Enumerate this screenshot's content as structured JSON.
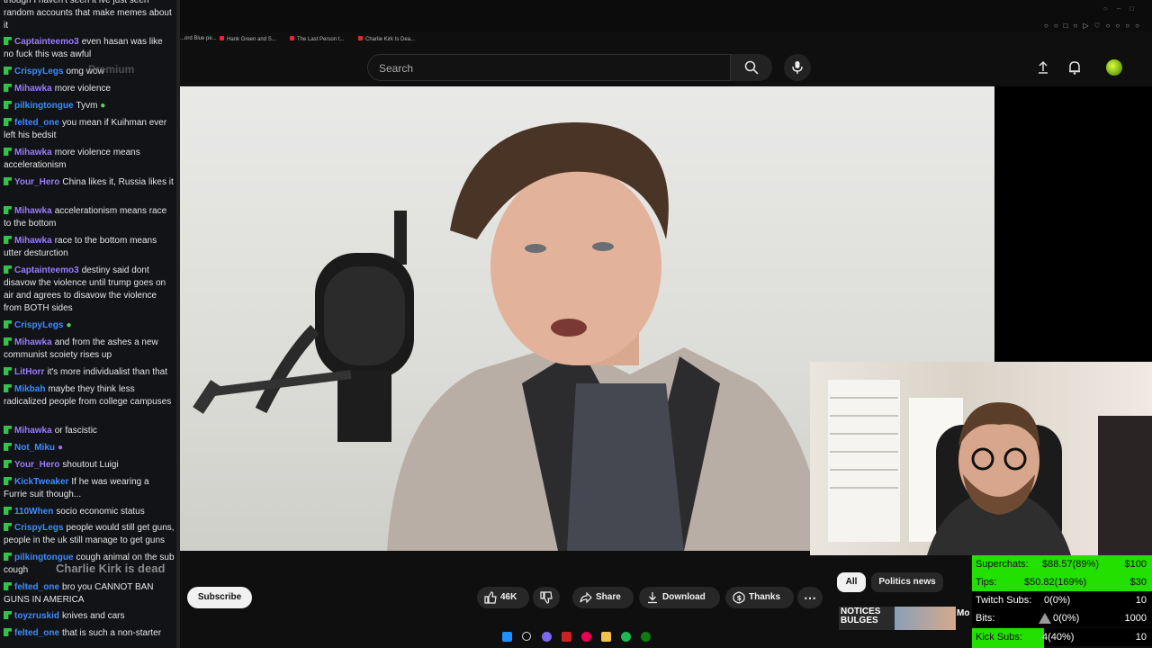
{
  "chat": {
    "messages": [
      {
        "user": "",
        "text": "though I haven't seen it ive just seen random accounts that make memes about it",
        "color": "#9b7bff"
      },
      {
        "user": "Captainteemo3",
        "text": "even hasan was like no fuck this was awful",
        "color": "#9b7bff"
      },
      {
        "user": "CrispyLegs",
        "text": "omg wow",
        "color": "#3d8cff"
      },
      {
        "user": "Mihawka",
        "text": "more violence",
        "color": "#9b7bff"
      },
      {
        "user": "pilkingtongue",
        "text": "Tyvm",
        "color": "#3d8cff"
      },
      {
        "user": "felted_one",
        "text": "you mean if Kuihman ever left his bedsit",
        "color": "#3d8cff"
      },
      {
        "user": "Mihawka",
        "text": "more violence means accelerationism",
        "color": "#9b7bff"
      },
      {
        "user": "Your_Hero",
        "text": "China likes it, Russia likes it",
        "color": "#9b7bff"
      },
      {
        "user": "Mihawka",
        "text": "accelerationism means race to the bottom",
        "color": "#9b7bff"
      },
      {
        "user": "Mihawka",
        "text": "race to the bottom means utter desturction",
        "color": "#9b7bff"
      },
      {
        "user": "Captainteemo3",
        "text": "destiny said dont disavow the violence until trump goes on air and agrees to disavow the violence from BOTH sides",
        "color": "#9b7bff"
      },
      {
        "user": "CrispyLegs",
        "text": "",
        "color": "#3d8cff"
      },
      {
        "user": "Mihawka",
        "text": "and from the ashes a new communist scoiety rises up",
        "color": "#9b7bff"
      },
      {
        "user": "LitHorr",
        "text": "it's more individualist than that",
        "color": "#9b7bff"
      },
      {
        "user": "Mikbah",
        "text": "maybe they think less radicalized people from college campuses",
        "color": "#3d8cff"
      },
      {
        "user": "Mihawka",
        "text": "or fascistic",
        "color": "#9b7bff"
      },
      {
        "user": "Not_Miku",
        "text": "",
        "color": "#3d8cff"
      },
      {
        "user": "Your_Hero",
        "text": "shoutout Luigi",
        "color": "#9b7bff"
      },
      {
        "user": "KickTweaker",
        "text": "If he was wearing a Furrie suit though...",
        "color": "#3d8cff"
      },
      {
        "user": "110When",
        "text": "socio economic status",
        "color": "#3d8cff"
      },
      {
        "user": "CrispyLegs",
        "text": "people would still get guns, people in the uk still manage to get guns",
        "color": "#3d8cff"
      },
      {
        "user": "pilkingtongue",
        "text": "cough animal on the sub cough",
        "color": "#3d8cff"
      },
      {
        "user": "felted_one",
        "text": "bro you CANNOT BAN GUNS IN AMERICA",
        "color": "#3d8cff"
      },
      {
        "user": "toyzruskid",
        "text": "knives and cars",
        "color": "#3d8cff"
      },
      {
        "user": "felted_one",
        "text": "that is such a non-starter",
        "color": "#3d8cff"
      }
    ]
  },
  "browser": {
    "bookmarks": [
      "...ord Blue pe...",
      "Hank Green and S...",
      "The Last Person t...",
      "Charlie Kirk Is Dea..."
    ]
  },
  "youtube": {
    "logo_text": "Premium",
    "search_placeholder": "Search",
    "channel_name": "Charlie Kirk is dead",
    "subscribe_label": "Subscribe",
    "like_count": "46K",
    "share_label": "Share",
    "download_label": "Download",
    "thanks_label": "Thanks",
    "chips": [
      "All",
      "Politics news"
    ],
    "thumb_text": "NOTICES BULGES",
    "thumb_side": "Mo Aft"
  },
  "stats": {
    "superchats_label": "Superchats:",
    "superchats_value": "$88.57(89%)",
    "superchats_goal": "$100",
    "tips_label": "Tips:",
    "tips_value": "$50.82(169%)",
    "tips_goal": "$30",
    "twitch_label": "Twitch Subs:",
    "twitch_value": "0(0%)",
    "twitch_goal": "10",
    "bits_label": "Bits:",
    "bits_value": "0(0%)",
    "bits_goal": "1000",
    "kick_label": "Kick Subs:",
    "kick_value": "4(40%)",
    "kick_goal": "10"
  },
  "colors": {
    "accent_green": "#22e000",
    "badge_green": "#35c24a"
  }
}
